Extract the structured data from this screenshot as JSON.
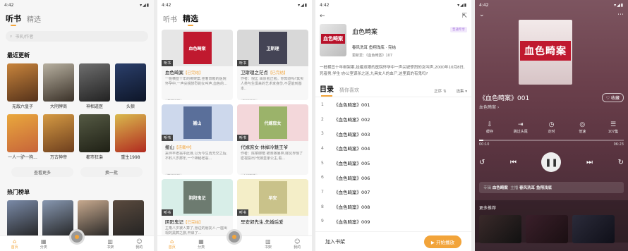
{
  "status_time": "4:42",
  "listen": {
    "tabs": [
      "听书",
      "精选"
    ],
    "search_placeholder": "书名/作者",
    "recent_title": "最近更新",
    "books": [
      {
        "title": "无敌六皇子",
        "color": "#c8843c",
        "color2": "#55321a"
      },
      {
        "title": "大阴牌商",
        "color": "#b7b0a0",
        "color2": "#3a3128"
      },
      {
        "title": "神相道医",
        "color": "#6e6e6e",
        "color2": "#222"
      },
      {
        "title": "头狼",
        "color": "#2b3f6b",
        "color2": "#0d1527"
      },
      {
        "title": "一人一驴一狗...",
        "color": "#e9a83d",
        "color2": "#c7643a"
      },
      {
        "title": "万古神帝",
        "color": "#d59a43",
        "color2": "#6e3f1e"
      },
      {
        "title": "都市狂枭",
        "color": "#555a44",
        "color2": "#1f2015"
      },
      {
        "title": "重生1998",
        "color": "#d9b94d",
        "color2": "#b12a20"
      }
    ],
    "btn_more": "查看更多",
    "btn_swap": "换一批",
    "hot_title": "热门榜单",
    "hot": [
      {
        "color": "#7a8aa7"
      },
      {
        "color": "#8797b0"
      },
      {
        "color": "#c7a98e"
      },
      {
        "color": "#5a4a3e"
      }
    ]
  },
  "nav": [
    {
      "label": "首页",
      "icon": "⌂"
    },
    {
      "label": "分类",
      "icon": "▦"
    },
    {
      "label": "书架",
      "icon": "▥"
    },
    {
      "label": "我的",
      "icon": "☺"
    }
  ],
  "select": {
    "tabs": [
      "听书",
      "精选"
    ],
    "cards": [
      {
        "title": "血色畸案",
        "tag": "【已完结】",
        "desc": "一桩横亘十年的绑架案,挂着双眼的医院怀孕中,一声尖锐惨烈的女叫声,血色的...",
        "chip": "悬疑推理",
        "badge": "听书",
        "bg": "#e6e6e6",
        "cover_text": "血色畸案",
        "cover_color": "#c0192f"
      },
      {
        "title": "卫斯理之茫点",
        "tag": "【已完结】",
        "desc": "作者：倪匡 由原著正著。你知道吗?其实人类与生俱来的艺术家身份,不足能到基本..",
        "chip": "科幻灵异",
        "badge": "听书",
        "bg": "#d8d8d8",
        "cover_text": "卫斯理",
        "cover_color": "#445"
      },
      {
        "title": "搬山",
        "tag": "【连载中】",
        "desc": "采伴丰老翁中此身,以为今生再无交之后,不料八岁那年,一个神秘老翁...",
        "chip": "玄幻灵异",
        "badge": "听书",
        "bg": "#cdd8ec",
        "cover_text": "搬山",
        "cover_color": "#5a6f9a"
      },
      {
        "title": "代嫁庶女·休掉冷魅王爷",
        "tag": "",
        "desc": "作者：陈菜御暄 被亲嫁暴弃,嫁冥界惊了密视投出!代嫁皇家公主,看...",
        "chip": "古代言情",
        "badge": "听书",
        "bg": "#f3d7da",
        "cover_text": "代嫁庶女",
        "cover_color": "#9bb36a"
      },
      {
        "title": "阴阳鬼记",
        "tag": "【已完结】",
        "desc": "主角八岁被人算了,身边的朋友人,一座出现的黑葬之旅,开启了...",
        "chip": "",
        "badge": "听书",
        "bg": "#d8eee8",
        "cover_text": "阴阳鬼记",
        "cover_color": "#6d7b70"
      },
      {
        "title": "早安郭先生,先婚后爱",
        "tag": "",
        "desc": "",
        "chip": "",
        "badge": "听书",
        "bg": "#f4eec8",
        "cover_text": "早安",
        "cover_color": "#c9c28a"
      }
    ]
  },
  "detail": {
    "title": "血色畸案",
    "vip": "普通专享",
    "meta": "春风洗耳 鱼翔浅底 · 完结",
    "update": "更新至：《血色畸案》107",
    "intro": "一桩横亘十年绑架案,挂着双眼的医院怀孕中一声尖锐惨烈的女叫声,2000年10月8日,死者男,学生!办公室谋杀之迷,九具女人的血尸,这里真的有鬼吗?",
    "tab_list": "目录",
    "tab_like": "猜你喜欢",
    "sort": "正序 ⇅",
    "select": "选集 ▾",
    "episodes": [
      {
        "n": "1",
        "t": "《血色畸案》001"
      },
      {
        "n": "2",
        "t": "《血色畸案》002"
      },
      {
        "n": "3",
        "t": "《血色畸案》003"
      },
      {
        "n": "4",
        "t": "《血色畸案》004"
      },
      {
        "n": "5",
        "t": "《血色畸案》005"
      },
      {
        "n": "6",
        "t": "《血色畸案》006"
      },
      {
        "n": "7",
        "t": "《血色畸案》007"
      },
      {
        "n": "8",
        "t": "《血色畸案》008"
      },
      {
        "n": "9",
        "t": "《血色畸案》009"
      }
    ],
    "add_shelf": "加入书架",
    "start_play": "开始播放"
  },
  "player": {
    "cover_text": "血色畸案",
    "track": "《血色畸案》001",
    "album": "血色畸案 ›",
    "collect": "♡ 收藏",
    "actions": [
      {
        "label": "缓存",
        "icon": "⇩"
      },
      {
        "label": "跳过头尾",
        "icon": "⇥"
      },
      {
        "label": "定时",
        "icon": "◷"
      },
      {
        "label": "倍速",
        "icon": "◎"
      },
      {
        "label": "107集",
        "icon": "☰"
      }
    ],
    "time_current": "00:10",
    "time_total": "06:23",
    "progress": 0.03,
    "credit_label1": "专辑",
    "credit_value1": "血色畸案",
    "credit_label2": "主播",
    "credit_value2": "春风洗耳 鱼翔浅底",
    "more_title": "更多推荐"
  }
}
